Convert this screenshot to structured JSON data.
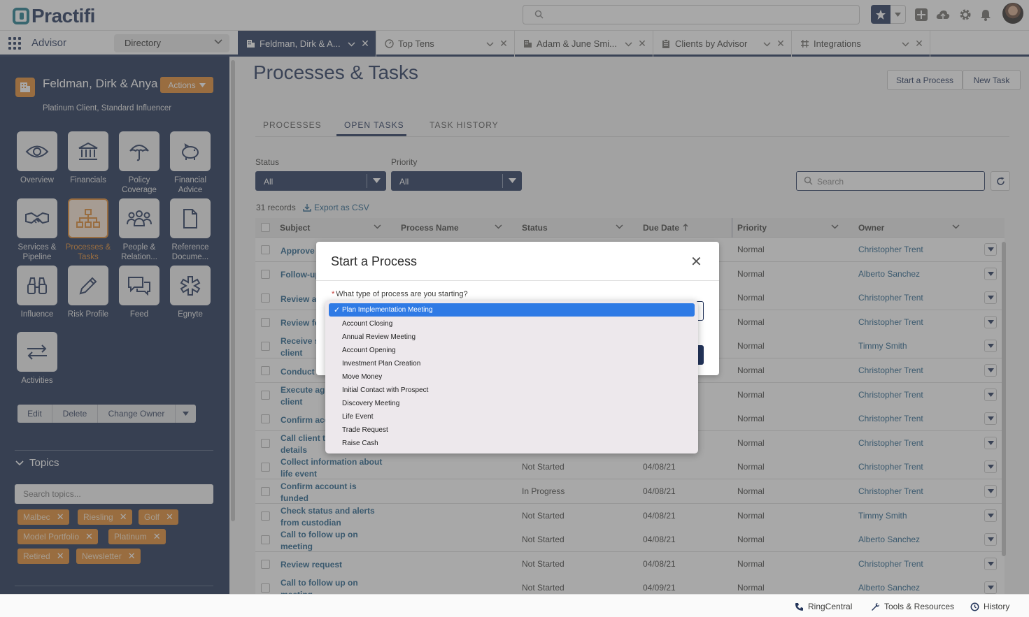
{
  "app": {
    "logo_text": "Practifi",
    "name": "Advisor",
    "directory_label": "Directory"
  },
  "tabs": [
    {
      "label": "Feldman, Dirk & A...",
      "icon": "building-icon",
      "active": true
    },
    {
      "label": "Top Tens",
      "icon": "speedometer-icon",
      "active": false
    },
    {
      "label": "Adam & June Smi...",
      "icon": "building-icon",
      "active": false
    },
    {
      "label": "Clients by Advisor",
      "icon": "clipboard-icon",
      "active": false
    },
    {
      "label": "Integrations",
      "icon": "integrations-icon",
      "active": false
    }
  ],
  "account": {
    "name": "Feldman, Dirk & Anya",
    "subtitle": "Platinum Client, Standard Influencer",
    "actions_label": "Actions"
  },
  "tiles": [
    {
      "label": "Overview",
      "icon": "eye-icon"
    },
    {
      "label": "Financials",
      "icon": "bank-icon"
    },
    {
      "label": "Policy Coverage",
      "icon": "umbrella-icon"
    },
    {
      "label": "Financial Advice",
      "icon": "piggy-bank-icon"
    },
    {
      "label": "Services & Pipeline",
      "icon": "handshake-icon"
    },
    {
      "label": "Processes & Tasks",
      "icon": "hierarchy-icon",
      "active": true
    },
    {
      "label": "People & Relation...",
      "icon": "people-icon"
    },
    {
      "label": "Reference Docume...",
      "icon": "document-icon"
    },
    {
      "label": "Influence",
      "icon": "binoculars-icon"
    },
    {
      "label": "Risk Profile",
      "icon": "pencil-icon"
    },
    {
      "label": "Feed",
      "icon": "chat-icon"
    },
    {
      "label": "Egnyte",
      "icon": "egnyte-icon"
    },
    {
      "label": "Activities",
      "icon": "arrows-icon"
    }
  ],
  "record_actions": {
    "edit": "Edit",
    "delete": "Delete",
    "change_owner": "Change Owner"
  },
  "topics": {
    "title": "Topics",
    "search_placeholder": "Search topics...",
    "tags": [
      "Malbec",
      "Riesling",
      "Golf",
      "Model Portfolio",
      "Platinum",
      "Retired",
      "Newsletter"
    ]
  },
  "main": {
    "title": "Processes & Tasks",
    "start_process_label": "Start a Process",
    "new_task_label": "New Task",
    "subtabs": [
      "PROCESSES",
      "OPEN TASKS",
      "TASK HISTORY"
    ],
    "status_label": "Status",
    "status_value": "All",
    "priority_label": "Priority",
    "priority_value": "All",
    "search_placeholder": "Search",
    "records_count": "31 records",
    "export_label": "Export as CSV"
  },
  "table": {
    "columns": [
      "Subject",
      "Process Name",
      "Status",
      "Due Date",
      "Priority",
      "Owner"
    ],
    "rows": [
      {
        "subject": "Approve client request",
        "status": "",
        "due": "",
        "priority": "Normal",
        "owner": "Christopher Trent"
      },
      {
        "subject": "Follow-up Meeting Notes",
        "status": "",
        "due": "",
        "priority": "Normal",
        "owner": "Alberto Sanchez"
      },
      {
        "subject": "Review account",
        "status": "",
        "due": "",
        "priority": "Normal",
        "owner": "Christopher Trent"
      },
      {
        "subject": "Review for approval",
        "status": "",
        "due": "",
        "priority": "Normal",
        "owner": "Christopher Trent"
      },
      {
        "subject": "Receive signed docs from client",
        "status": "",
        "due": "",
        "priority": "Normal",
        "owner": "Timmy Smith"
      },
      {
        "subject": "Conduct meeting",
        "status": "",
        "due": "",
        "priority": "Normal",
        "owner": "Christopher Trent"
      },
      {
        "subject": "Execute agreement with client",
        "status": "",
        "due": "",
        "priority": "Normal",
        "owner": "Christopher Trent"
      },
      {
        "subject": "Confirm account",
        "status": "",
        "due": "",
        "priority": "Normal",
        "owner": "Christopher Trent"
      },
      {
        "subject": "Call client to confirm level details",
        "status": "",
        "due": "",
        "priority": "Normal",
        "owner": "Christopher Trent"
      },
      {
        "subject": "Collect information about life event",
        "status": "Not Started",
        "due": "04/08/21",
        "priority": "Normal",
        "owner": "Christopher Trent"
      },
      {
        "subject": "Confirm account is funded",
        "status": "In Progress",
        "due": "04/08/21",
        "priority": "Normal",
        "owner": "Christopher Trent"
      },
      {
        "subject": "Check status and alerts from custodian",
        "status": "Not Started",
        "due": "04/08/21",
        "priority": "Normal",
        "owner": "Timmy Smith"
      },
      {
        "subject": "Call to follow up on meeting",
        "status": "Not Started",
        "due": "04/08/21",
        "priority": "Normal",
        "owner": "Alberto Sanchez"
      },
      {
        "subject": "Review request",
        "status": "Not Started",
        "due": "04/08/21",
        "priority": "Normal",
        "owner": "Christopher Trent"
      },
      {
        "subject": "Call to follow up on meeting",
        "status": "Not Started",
        "due": "04/09/21",
        "priority": "Normal",
        "owner": "Alberto Sanchez"
      }
    ]
  },
  "footer": {
    "ringcentral": "RingCentral",
    "tools": "Tools & Resources",
    "history": "History"
  },
  "modal": {
    "title": "Start a Process",
    "question": "What type of process are you starting?",
    "required_mark": "*",
    "options": [
      "Plan Implementation Meeting",
      "Account Closing",
      "Annual Review Meeting",
      "Account Opening",
      "Investment Plan Creation",
      "Move Money",
      "Initial Contact with Prospect",
      "Discovery Meeting",
      "Life Event",
      "Trade Request",
      "Raise Cash"
    ],
    "selected": "Plan Implementation Meeting"
  },
  "colors": {
    "navy": "#23345a",
    "accent": "#e0892e",
    "link": "#23608a",
    "highlight": "#2f7ae5"
  }
}
